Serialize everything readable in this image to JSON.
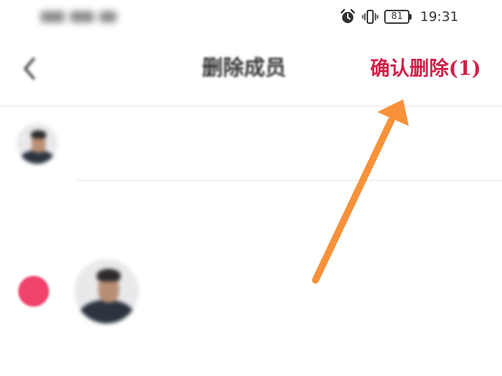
{
  "status_bar": {
    "carrier": "",
    "icons": [
      "alarm-icon",
      "vibrate-icon",
      "battery-icon"
    ],
    "battery_level": "81",
    "time": "19:31"
  },
  "header": {
    "back_icon": "chevron-left-icon",
    "title": "删除成员",
    "confirm_label": "确认删除(1)"
  },
  "members": [
    {
      "name": "",
      "avatar_icon": "avatar-photo",
      "selected": false
    },
    {
      "name": "",
      "avatar_icon": "avatar-photo",
      "selected": true
    }
  ],
  "section_label": "",
  "colors": {
    "accent": "#d21f48",
    "selection_dot": "#f0426a",
    "annotation_arrow": "#f7923a"
  }
}
